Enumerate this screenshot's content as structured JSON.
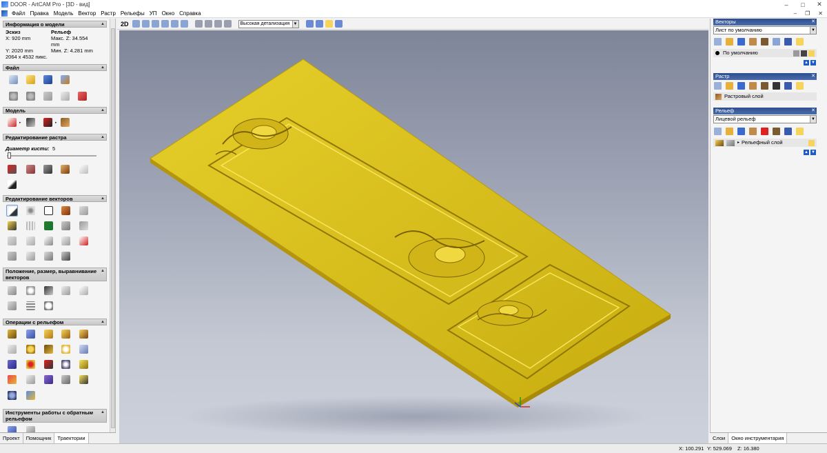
{
  "window": {
    "title": "DOOR - ArtCAM Pro - [3D - вид]"
  },
  "menu": {
    "items": [
      "Файл",
      "Правка",
      "Модель",
      "Вектор",
      "Растр",
      "Рельефы",
      "УП",
      "Окно",
      "Справка"
    ]
  },
  "left_panel": {
    "model_info": {
      "header": "Информация о модели",
      "sketch_label": "Эскиз",
      "relief_label": "Рельеф",
      "x_value": "X: 920 mm",
      "max_z": "Макс. Z: 34.554",
      "max_z_unit": "mm",
      "y_value": "Y: 2020 mm",
      "min_z": "Мин. Z: 4.281 mm",
      "pixels": "2064 x 4532 пикс."
    },
    "sections": {
      "file": "Файл",
      "model": "Модель",
      "raster_edit": "Редактирование растра",
      "vector_edit": "Редактирование векторов",
      "position": "Положение, размер, выравнивание векторов",
      "relief_ops": "Операции с рельефом",
      "inverse_tools": "Инструменты работы с обратным рельефом"
    },
    "brush": {
      "label": "Диаметр кисти:",
      "value": "5"
    },
    "tabs": [
      "Проект",
      "Помощник",
      "Траектории"
    ]
  },
  "view_toolbar": {
    "mode_2d": "2D",
    "detail_select": "Высокая детализация"
  },
  "right_panel": {
    "vectors": {
      "header": "Векторы",
      "sheet": "Лист по умолчанию",
      "layer": "По умолчанию"
    },
    "raster": {
      "header": "Растр",
      "layer": "Растровый слой"
    },
    "relief": {
      "header": "Рельеф",
      "select": "Лицевой рельеф",
      "layer": "Рельефный слой"
    },
    "tabs": [
      "Слои",
      "Окно инструментария"
    ]
  },
  "status": {
    "x": "X: 100.291",
    "y": "Y: 529.069",
    "z": "Z: 16.380"
  },
  "colors": {
    "panel_gold": "#e0c81e",
    "header_blue": "#2e4f8f"
  }
}
